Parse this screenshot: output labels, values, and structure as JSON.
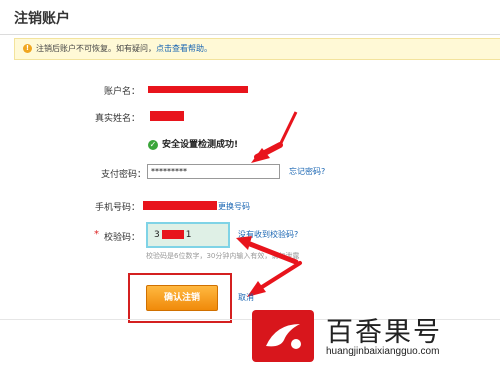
{
  "page": {
    "title": "注销账户"
  },
  "notice": {
    "text": "注销后账户不可恢复。如有疑问，",
    "help_link": "点击查看帮助。"
  },
  "form": {
    "account_label": "账户名：",
    "realname_label": "真实姓名：",
    "security_check": "安全设置检测成功!",
    "password_label": "支付密码：",
    "password_value": "*********",
    "forgot_password_link": "忘记密码?",
    "phone_label": "手机号码：",
    "change_phone_link": "更换号码",
    "code_label": "校验码：",
    "code_value": "3",
    "code_value_tail": "1",
    "resend_link": "没有收到校验码?",
    "code_hint": "校验码是6位数字，30分钟内输入有效，请勿泄露",
    "confirm_button": "确认注销",
    "cancel_link": "取消"
  },
  "watermark": {
    "title": "百香果号",
    "url": "huangjinbaixiangguo.com"
  },
  "colors": {
    "redaction": "#e8141c",
    "annotation_box": "#d42020",
    "link": "#1a66b3",
    "button_orange": "#f08a0a"
  }
}
